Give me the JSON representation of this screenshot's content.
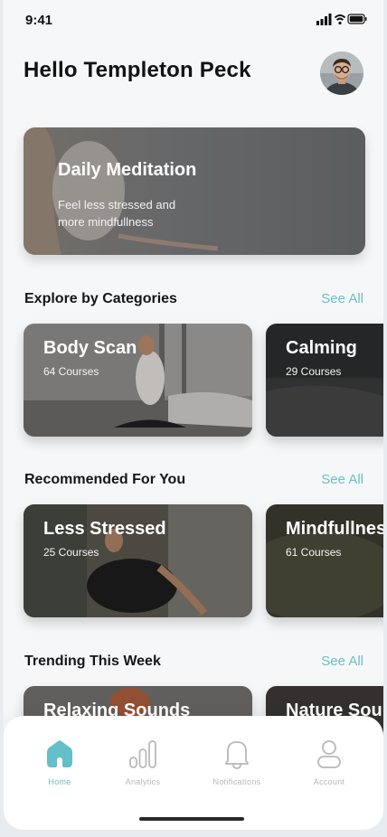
{
  "status_bar": {
    "time": "9:41"
  },
  "header": {
    "greeting": "Hello Templeton Peck"
  },
  "hero": {
    "title": "Daily Meditation",
    "subtitle": "Feel less stressed and more mindfullness"
  },
  "sections": [
    {
      "title": "Explore by Categories",
      "see_all": "See All",
      "cards": [
        {
          "title": "Body Scan",
          "count": "64 Courses"
        },
        {
          "title": "Calming",
          "count": "29 Courses"
        }
      ]
    },
    {
      "title": "Recommended For You",
      "see_all": "See All",
      "cards": [
        {
          "title": "Less Stressed",
          "count": "25 Courses"
        },
        {
          "title": "Mindfullnes",
          "count": "61 Courses"
        }
      ]
    },
    {
      "title": "Trending This Week",
      "see_all": "See All",
      "cards": [
        {
          "title": "Relaxing Sounds"
        },
        {
          "title": "Nature Sou"
        }
      ]
    }
  ],
  "tabbar": {
    "items": [
      {
        "label": "Home",
        "icon": "home-icon",
        "active": true
      },
      {
        "label": "Analytics",
        "icon": "analytics-icon",
        "active": false
      },
      {
        "label": "Notifications",
        "icon": "bell-icon",
        "active": false
      },
      {
        "label": "Account",
        "icon": "user-icon",
        "active": false
      }
    ]
  },
  "colors": {
    "accent": "#6BC0C8",
    "background": "#F6F7F8",
    "text": "#121212"
  }
}
